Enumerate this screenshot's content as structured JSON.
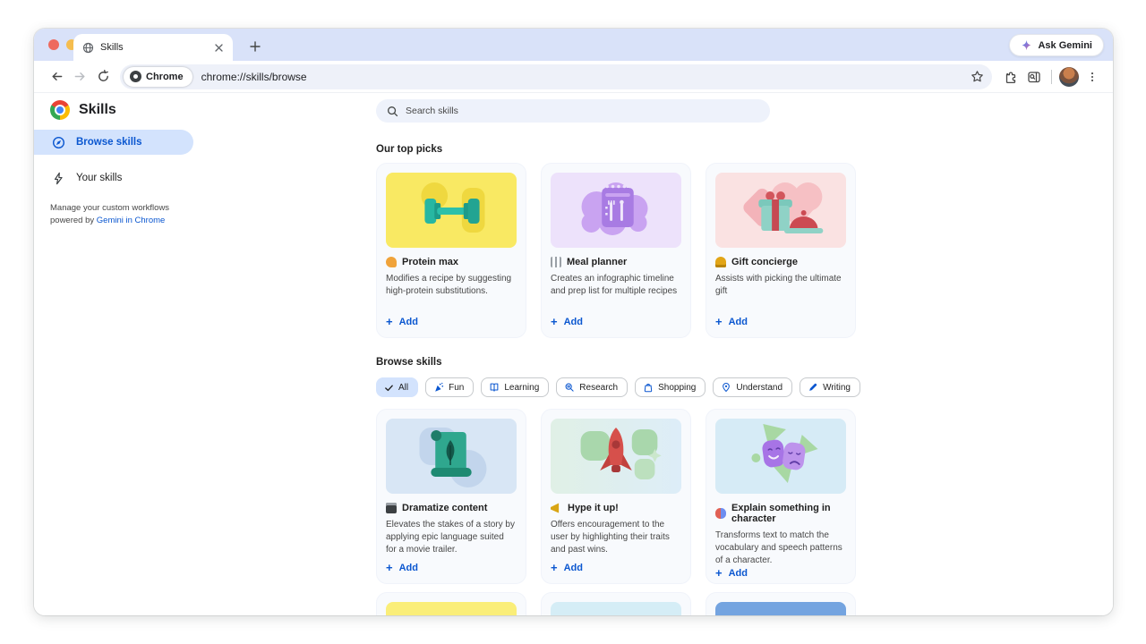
{
  "browser": {
    "tab_title": "Skills",
    "url": "chrome://skills/browse",
    "site_chip_label": "Chrome",
    "ask_gemini_label": "Ask Gemini"
  },
  "icons": {
    "close_tab": "×",
    "new_tab": "+",
    "more_menu": "⋮",
    "check": "✓",
    "search": "🔍",
    "add_plus": "+"
  },
  "page": {
    "app_title": "Skills",
    "nav": [
      {
        "label": "Browse skills",
        "selected": true
      },
      {
        "label": "Your skills",
        "selected": false
      }
    ],
    "caption": {
      "line1": "Manage your custom workflows",
      "line2_prefix": "powered by ",
      "link": "Gemini in Chrome"
    },
    "search_placeholder": "Search skills",
    "add_button": {
      "plus": "+",
      "label": "Add"
    },
    "sections": {
      "top_picks": {
        "heading": "Our top picks",
        "cards": [
          {
            "icon": "flexed-biceps",
            "title": "Protein max",
            "description": "Modifies a recipe by suggesting high-protein substitutions."
          },
          {
            "icon": "meal-calendar",
            "title": "Meal planner",
            "description": "Creates an infographic timeline and prep list for multiple recipes"
          },
          {
            "icon": "bellhop-bell",
            "title": "Gift concierge",
            "description": "Assists with picking the ultimate gift"
          }
        ]
      },
      "browse": {
        "heading": "Browse skills",
        "filters": [
          {
            "label": "All",
            "selected": true
          },
          {
            "label": "Fun",
            "selected": false
          },
          {
            "label": "Learning",
            "selected": false
          },
          {
            "label": "Research",
            "selected": false
          },
          {
            "label": "Shopping",
            "selected": false
          },
          {
            "label": "Understand",
            "selected": false
          },
          {
            "label": "Writing",
            "selected": false
          }
        ],
        "cards": [
          {
            "icon": "clapper-board",
            "title": "Dramatize content",
            "description": "Elevates the stakes of a story by applying epic language suited for a movie trailer."
          },
          {
            "icon": "megaphone",
            "title": "Hype it up!",
            "description": "Offers encouragement to the user by highlighting their traits and past wins."
          },
          {
            "icon": "performing-arts-masks",
            "title": "Explain something in character",
            "description": "Transforms text to match the vocabulary and speech patterns of a character."
          }
        ]
      }
    }
  },
  "colors": {
    "accent_blue": "#0b57d0",
    "selected_pill": "#d3e3fd",
    "tabstrip": "#d9e2f9"
  }
}
